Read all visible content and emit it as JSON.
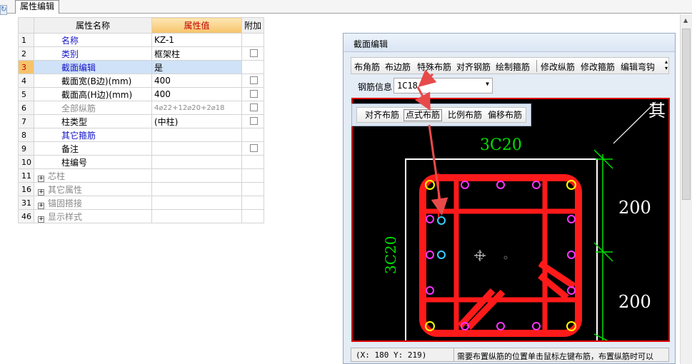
{
  "tab": {
    "label": "属性编辑"
  },
  "grid": {
    "headers": {
      "name": "属性名称",
      "value": "属性值",
      "attach": "附加"
    },
    "rows": [
      {
        "num": "1",
        "name": "名称",
        "value": "KZ-1",
        "style": "blue",
        "check": false
      },
      {
        "num": "2",
        "name": "类别",
        "value": "框架柱",
        "style": "blue",
        "check": true
      },
      {
        "num": "3",
        "name": "截面编辑",
        "value": "是",
        "style": "blue",
        "check": false
      },
      {
        "num": "4",
        "name": "截面宽(B边)(mm)",
        "value": "400",
        "style": "black",
        "check": true
      },
      {
        "num": "5",
        "name": "截面高(H边)(mm)",
        "value": "400",
        "style": "black",
        "check": true
      },
      {
        "num": "6",
        "name": "全部纵筋",
        "value": "4⌀22+12⌀20+2⌀18",
        "style": "gray",
        "check": true
      },
      {
        "num": "7",
        "name": "柱类型",
        "value": "(中柱)",
        "style": "black",
        "check": true
      },
      {
        "num": "8",
        "name": "其它箍筋",
        "value": "",
        "style": "blue",
        "check": false
      },
      {
        "num": "9",
        "name": "备注",
        "value": "",
        "style": "black",
        "check": true
      },
      {
        "num": "10",
        "name": "柱编号",
        "value": "",
        "style": "black",
        "check": false
      },
      {
        "num": "11",
        "name": "芯柱",
        "value": "",
        "style": "group",
        "check": false
      },
      {
        "num": "16",
        "name": "其它属性",
        "value": "",
        "style": "group",
        "check": false
      },
      {
        "num": "31",
        "name": "锚固搭接",
        "value": "",
        "style": "group",
        "check": false
      },
      {
        "num": "46",
        "name": "显示样式",
        "value": "",
        "style": "group",
        "check": false
      }
    ]
  },
  "section_window": {
    "title": "截面编辑",
    "toolbar": [
      "布角筋",
      "布边筋",
      "特殊布筋",
      "对齐钢筋",
      "绘制箍筋",
      "修改纵筋",
      "修改箍筋",
      "编辑弯钩"
    ],
    "rebar_info_label": "钢筋信息",
    "rebar_info_value": "1C18",
    "mode_buttons": [
      "对齐布筋",
      "点式布筋",
      "比例布筋",
      "偏移布筋"
    ],
    "active_mode": "点式布筋",
    "canvas": {
      "top_label": "3C20",
      "left_label": "3C20",
      "dim_upper": "200",
      "dim_lower": "200",
      "corner_text": "其"
    },
    "status": {
      "coord": "(X: 180 Y: 219)",
      "hint": "需要布置纵筋的位置单击鼠标左键布筋，布置纵筋时可以"
    }
  },
  "colors": {
    "rebar": "#ff1a1a",
    "frame": "#ffffff",
    "dimension": "#00e000",
    "selected_row": "#cfe2f7",
    "header_accent": "#f6c36a"
  }
}
